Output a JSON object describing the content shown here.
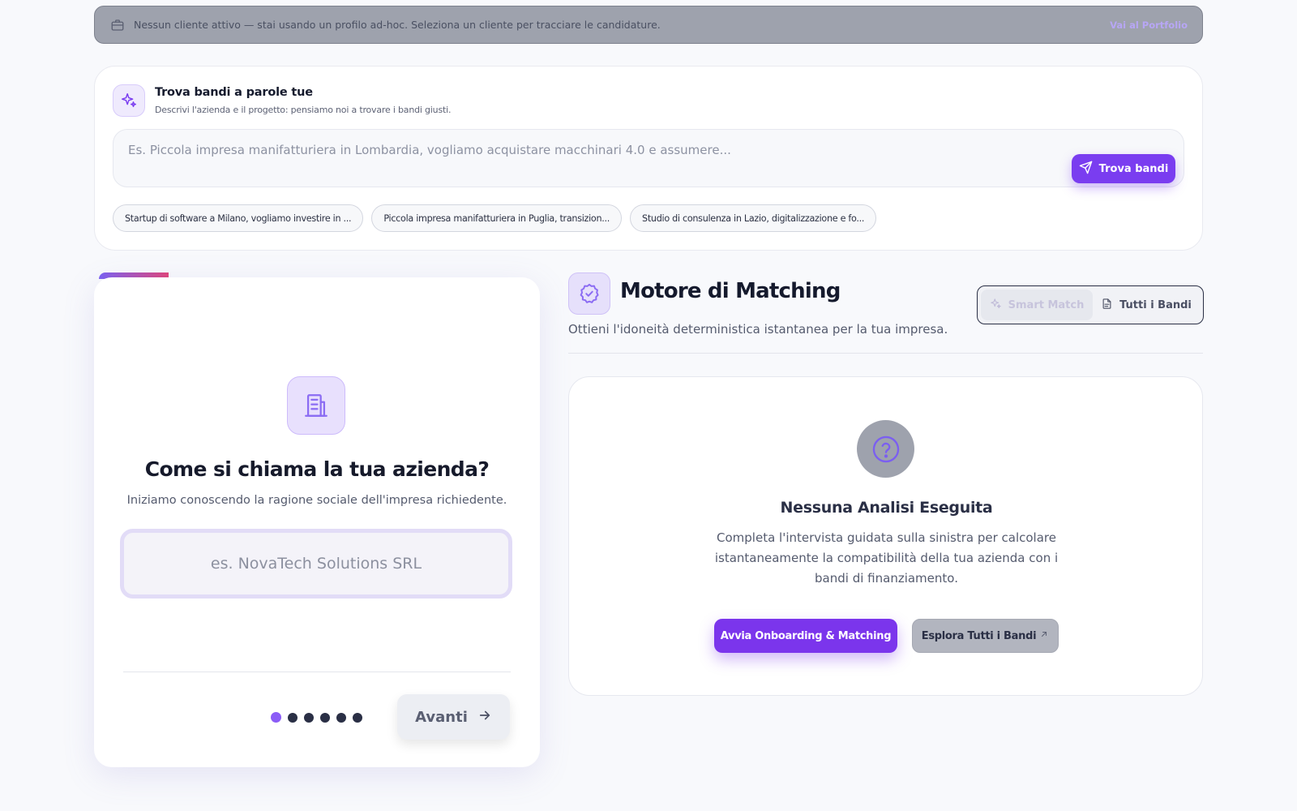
{
  "banner": {
    "text": "Nessun cliente attivo — stai usando un profilo ad-hoc. Seleziona un cliente per tracciare le candidature.",
    "link": "Vai al Portfolio",
    "icon": "briefcase-icon"
  },
  "search": {
    "title": "Trova bandi a parole tue",
    "subtitle": "Descrivi l'azienda e il progetto: pensiamo noi a trovare i bandi giusti.",
    "placeholder": "Es. Piccola impresa manifatturiera in Lombardia, vogliamo acquistare macchinari 4.0 e assumere...",
    "button": "Trova bandi",
    "icon": "sparkles-icon",
    "suggestions": [
      "Startup di software a Milano, vogliamo investire in ...",
      "Piccola impresa manifatturiera in Puglia, transizion...",
      "Studio di consulenza in Lazio, digitalizzazione e fo..."
    ]
  },
  "wizard": {
    "question": "Come si chiama la tua azienda?",
    "subtitle": "Iniziamo conoscendo la ragione sociale dell'impresa richiedente.",
    "placeholder": "es. NovaTech Solutions SRL",
    "next": "Avanti",
    "steps_total": 6,
    "current_step": 1,
    "icon": "building-icon"
  },
  "matching": {
    "title": "Motore di Matching",
    "subtitle": "Ottieni l'idoneità deterministica istantanea per la tua impresa.",
    "toggle": {
      "smart": "Smart Match",
      "all": "Tutti i Bandi"
    }
  },
  "result": {
    "title": "Nessuna Analisi Eseguita",
    "description": "Completa l'intervista guidata sulla sinistra per calcolare istantaneamente la compatibilità della tua azienda con i bandi di finanziamento.",
    "primary": "Avvia Onboarding & Matching",
    "secondary": "Esplora Tutti i Bandi"
  },
  "colors": {
    "accent": "#7a3df0",
    "accent_light": "#e8e0fd",
    "banner": "#9ea2ad"
  }
}
